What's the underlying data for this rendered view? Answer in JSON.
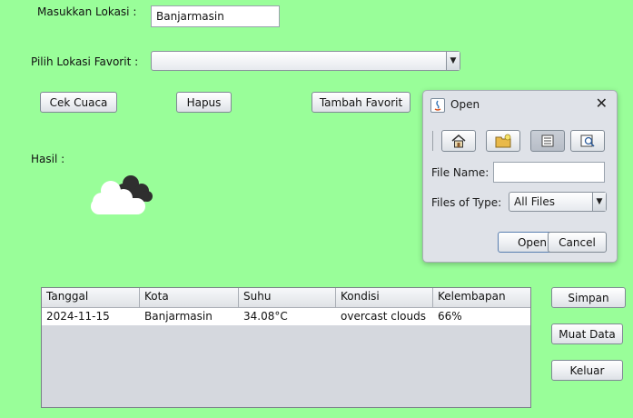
{
  "form": {
    "lokasi_label": "Masukkan Lokasi :",
    "lokasi_value": "Banjarmasin",
    "favorit_label": "Pilih Lokasi Favorit :",
    "favorit_value": "",
    "hasil_label": "Hasil :",
    "weather_icon": "cloud-icon"
  },
  "buttons": {
    "cek_cuaca": "Cek Cuaca",
    "hapus": "Hapus",
    "tambah_favorit": "Tambah Favorit",
    "simpan": "Simpan",
    "muat_data": "Muat Data",
    "keluar": "Keluar"
  },
  "table": {
    "columns": [
      "Tanggal",
      "Kota",
      "Suhu",
      "Kondisi",
      "Kelembapan"
    ],
    "rows": [
      [
        "2024-11-15",
        "Banjarmasin",
        "34.08°C",
        "overcast clouds",
        "66%"
      ]
    ]
  },
  "dialog": {
    "title": "Open",
    "file_name_label": "File Name:",
    "file_name_value": "",
    "files_of_type_label": "Files of Type:",
    "files_of_type_value": "All Files",
    "open_button": "Open",
    "cancel_button": "Cancel",
    "toolbar_icons": [
      "home-icon",
      "new-folder-icon",
      "list-view-icon",
      "details-view-icon"
    ]
  }
}
